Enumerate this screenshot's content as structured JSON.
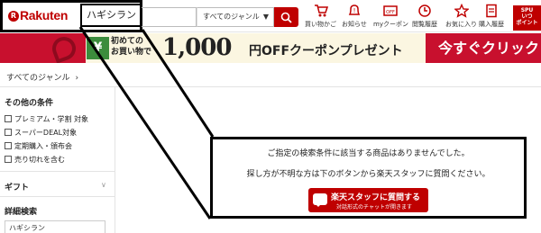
{
  "header": {
    "logo_mark": "R",
    "logo_text": "Rakuten",
    "search_value": "ハギシラン",
    "genre_select": "すべてのジャンル",
    "genre_arrow": "▼",
    "nav": [
      {
        "label": "買い物かご",
        "icon": "cart-icon"
      },
      {
        "label": "お知らせ",
        "icon": "bell-icon"
      },
      {
        "label": "myクーポン",
        "icon": "coupon-icon"
      },
      {
        "label": "閲覧履歴",
        "icon": "history-icon"
      },
      {
        "label": "お気に入り",
        "icon": "star-icon"
      },
      {
        "label": "購入履歴",
        "icon": "receipt-icon"
      }
    ],
    "spu_line1": "SPU",
    "spu_line2": "いつ",
    "spu_line3": "ポイント"
  },
  "banner": {
    "badge": "¥",
    "small_line1": "初めての",
    "small_line2": "お買い物で",
    "big": "1,000",
    "rest": "円OFFクーポンプレゼント",
    "cta": "今すぐクリック"
  },
  "breadcrumb": {
    "label": "すべてのジャンル",
    "sep": "›"
  },
  "sidebar": {
    "other_conditions_title": "その他の条件",
    "conditions": [
      "プレミアム・学割 対象",
      "スーパーDEAL対象",
      "定期購入・頒布会",
      "売り切れを含む"
    ],
    "gift_title": "ギフト",
    "gift_chevron": "∨",
    "detail_title": "詳細検索",
    "detail_value": "ハギシラン"
  },
  "message": {
    "line1": "ご指定の検索条件に該当する商品はありませんでした。",
    "line2": "探し方が不明な方は下のボタンから楽天スタッフに質問ください。",
    "button_main": "楽天スタッフに質問する",
    "button_sub": "対話形式のチャットが開きます"
  },
  "colors": {
    "brand_red": "#bf0000",
    "banner_bg": "#fbf6e1"
  }
}
